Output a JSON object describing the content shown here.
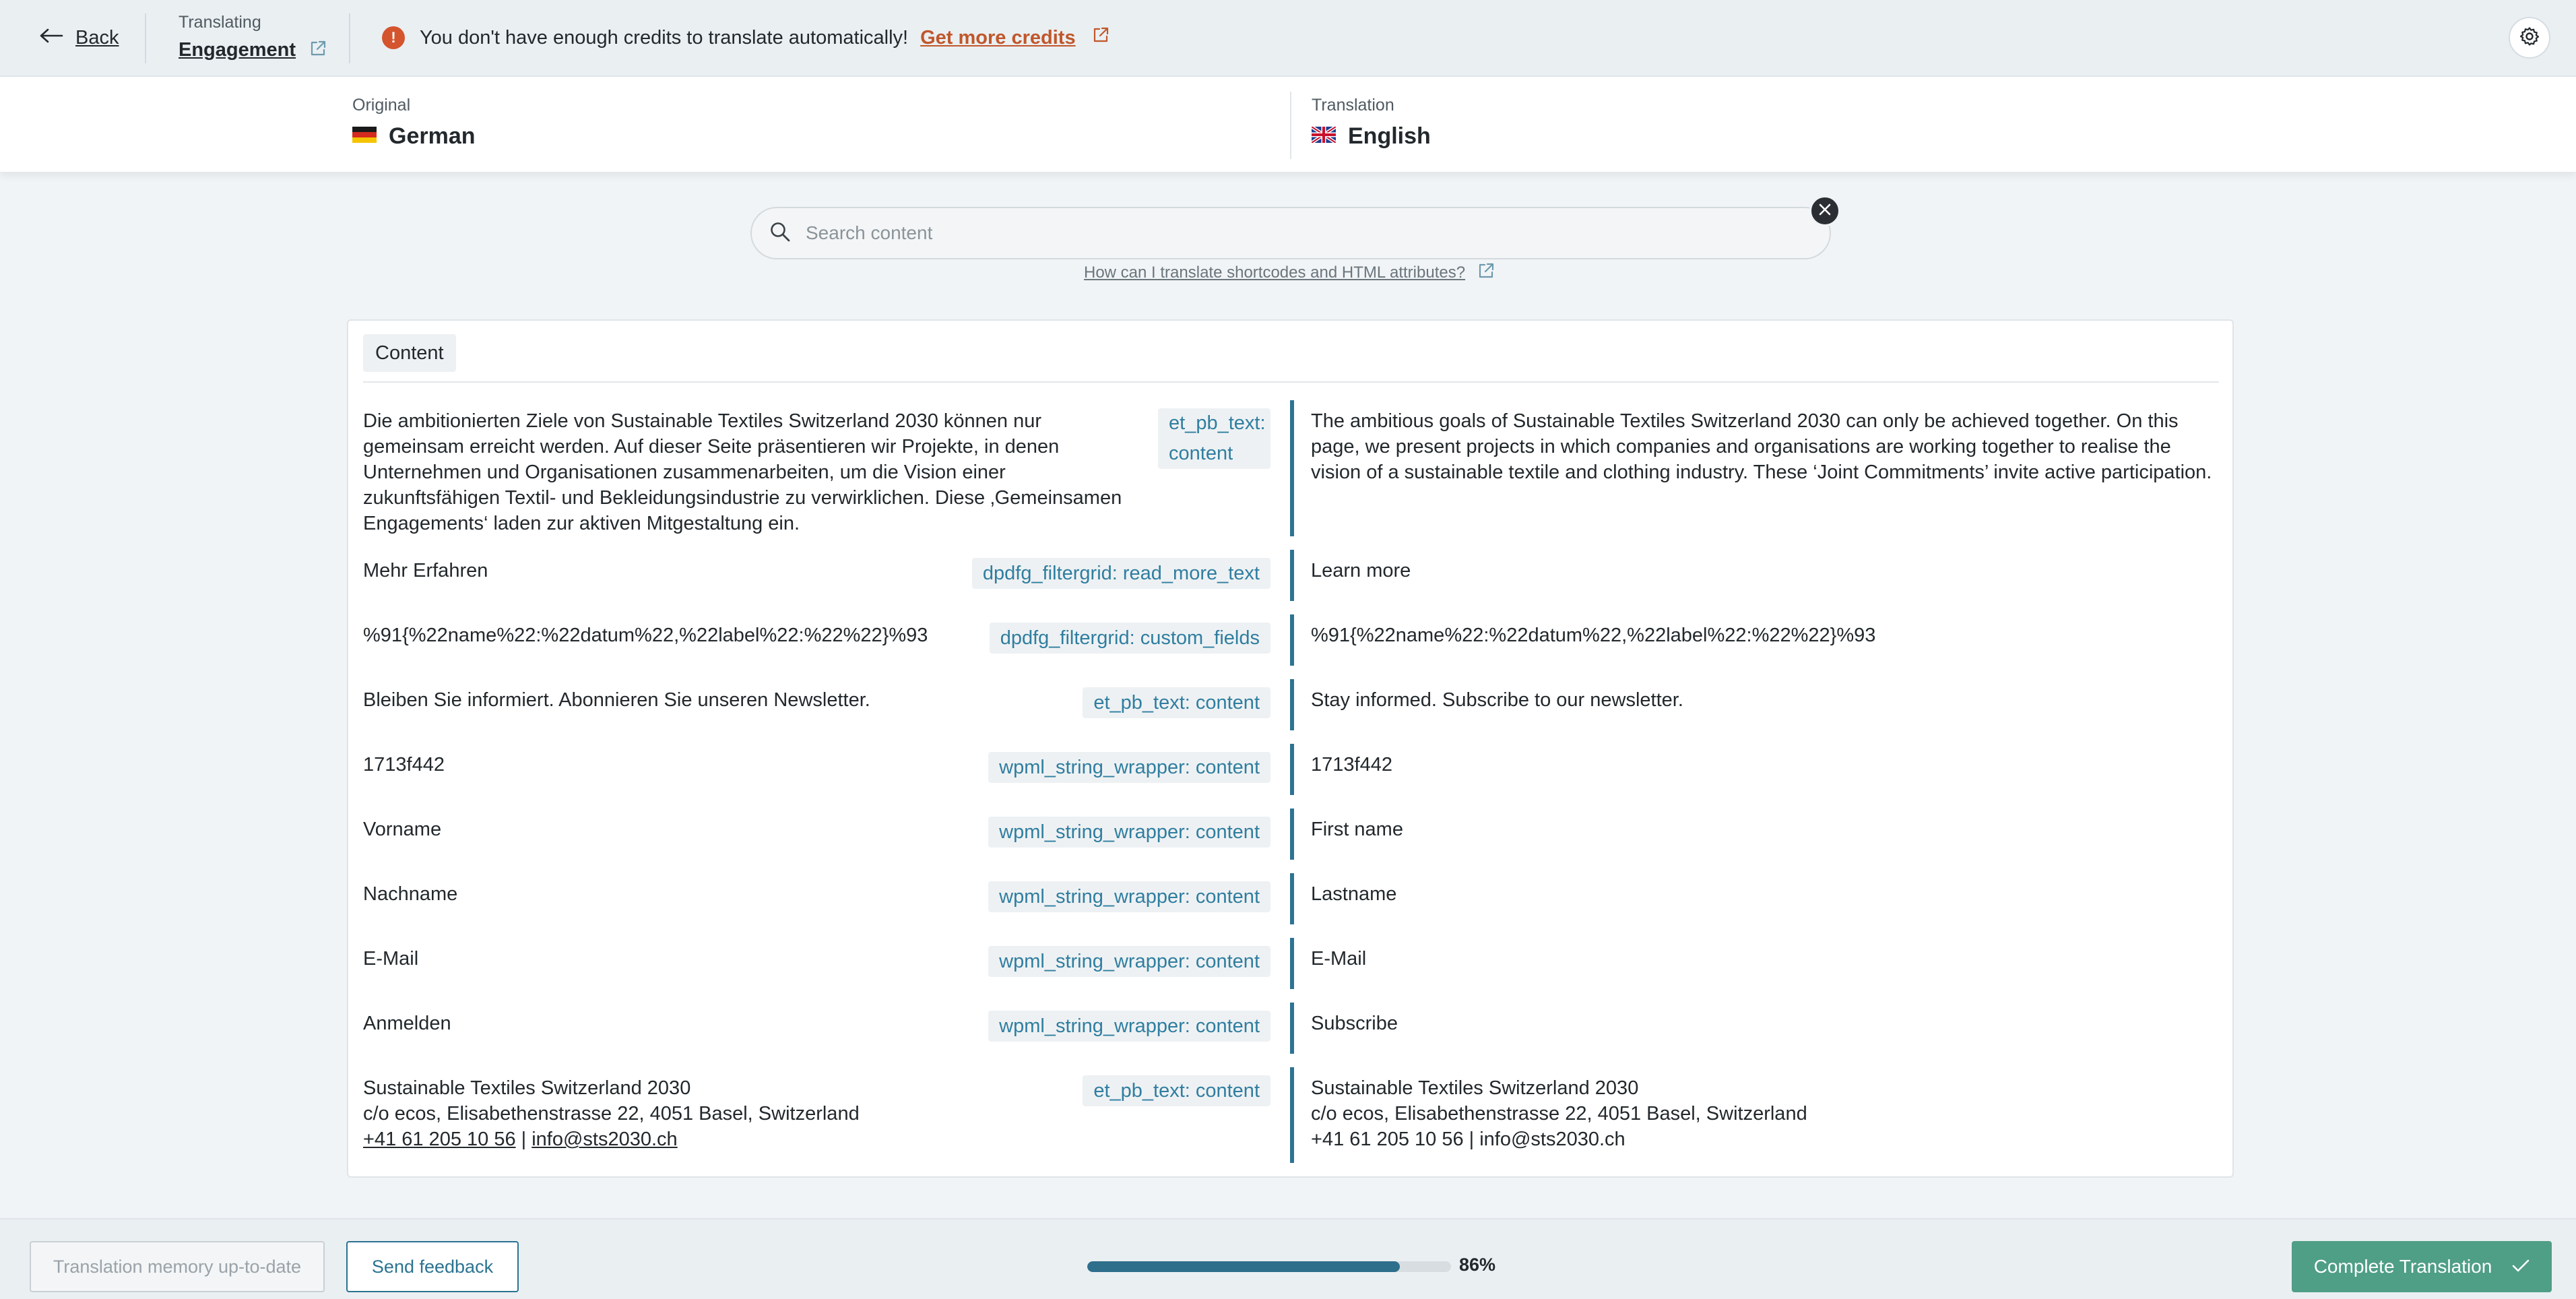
{
  "topbar": {
    "back_label": "Back",
    "translating_caption": "Translating",
    "page_name": "Engagement",
    "notice_text": "You don't have enough credits to translate automatically!",
    "notice_link": "Get more credits"
  },
  "languages": {
    "original_caption": "Original",
    "original_name": "German",
    "translation_caption": "Translation",
    "translation_name": "English"
  },
  "search": {
    "placeholder": "Search content",
    "help_link": "How can I translate shortcodes and HTML attributes?"
  },
  "content": {
    "section_label": "Content",
    "segments": [
      {
        "source": "Die ambitionierten Ziele von Sustainable Textiles Switzerland 2030 können nur gemeinsam erreicht werden. Auf dieser Seite präsentieren wir Projekte, in denen Unternehmen und Organisationen zusammenarbeiten, um die Vision einer zukunftsfähigen Textil- und Bekleidungsindustrie zu verwirklichen. Diese ‚Gemeinsamen Engagements‘ laden zur aktiven Mitgestaltung ein.",
        "tag_line1": "et_pb_text:",
        "tag_line2": "content",
        "target": "The ambitious goals of Sustainable Textiles Switzerland 2030 can only be achieved together. On this page, we present projects in which companies and organisations are working together to realise the vision of a sustainable textile and clothing industry. These ‘Joint Commitments’ invite active participation."
      },
      {
        "source": "Mehr Erfahren",
        "tag": "dpdfg_filtergrid: read_more_text",
        "target": "Learn more"
      },
      {
        "source": "%91{%22name%22:%22datum%22,%22label%22:%22%22}%93",
        "tag": "dpdfg_filtergrid: custom_fields",
        "target": "%91{%22name%22:%22datum%22,%22label%22:%22%22}%93"
      },
      {
        "source": "Bleiben Sie informiert. Abonnieren Sie unseren Newsletter.",
        "tag": "et_pb_text: content",
        "target": "Stay informed. Subscribe to our newsletter."
      },
      {
        "source": "1713f442",
        "tag": "wpml_string_wrapper: content",
        "target": "1713f442"
      },
      {
        "source": "Vorname",
        "tag": "wpml_string_wrapper: content",
        "target": "First name"
      },
      {
        "source": "Nachname",
        "tag": "wpml_string_wrapper: content",
        "target": "Lastname"
      },
      {
        "source": "E-Mail",
        "tag": "wpml_string_wrapper: content",
        "target": "E-Mail"
      },
      {
        "source": "Anmelden",
        "tag": "wpml_string_wrapper: content",
        "target": "Subscribe"
      },
      {
        "source_line1": "Sustainable Textiles Switzerland 2030",
        "source_line2": "c/o ecos, Elisabethenstrasse 22, 4051 Basel, Switzerland",
        "source_phone": "+41 61 205 10 56",
        "source_sep": " | ",
        "source_email": "info@sts2030.ch",
        "tag": "et_pb_text: content",
        "target_line1": "Sustainable Textiles Switzerland 2030",
        "target_line2": "c/o ecos, Elisabethenstrasse 22, 4051 Basel, Switzerland",
        "target_line3": "+41 61 205 10 56 | info@sts2030.ch"
      }
    ]
  },
  "footer": {
    "memory_button": "Translation memory up-to-date",
    "feedback_button": "Send feedback",
    "progress": 0.86,
    "progress_label": "86%",
    "complete_button": "Complete Translation"
  },
  "colors": {
    "accent": "#2e7393",
    "warning": "#d4542e",
    "complete": "#4f9e86"
  },
  "icons": [
    "arrow-left-icon",
    "external-link-icon",
    "warning-icon",
    "gear-icon",
    "flag-de-icon",
    "flag-gb-icon",
    "search-icon",
    "close-icon",
    "check-icon"
  ]
}
